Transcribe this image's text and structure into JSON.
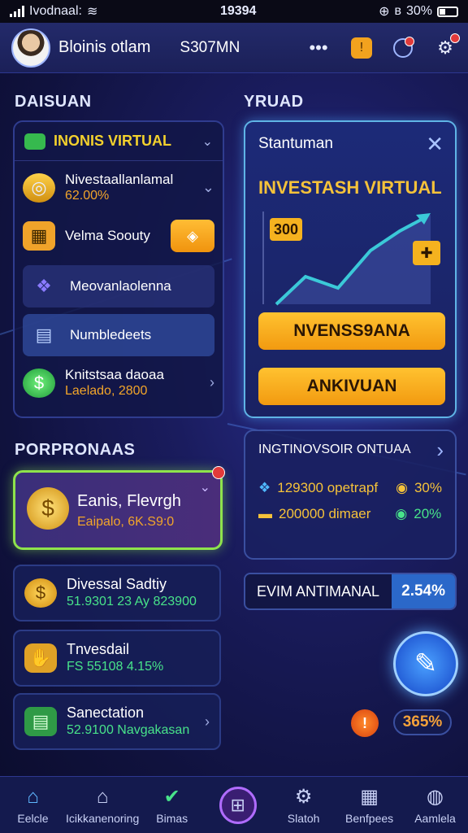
{
  "status_bar": {
    "carrier": "Ivodnaal:",
    "time": "19394",
    "battery": "30%"
  },
  "header": {
    "user_name": "Bloinis otlam",
    "balance": "S307MN",
    "more": "•••"
  },
  "sections": {
    "left_title": "DAISUAN",
    "right_title": "YRUAD",
    "promos_title": "PORPRONAAS"
  },
  "left_panel": {
    "title": "INONIS VIRTUAL",
    "items": [
      {
        "label": "Nivestaallanlamal",
        "sub": "62.00%"
      },
      {
        "label": "Velma Soouty"
      },
      {
        "label": "Meovanlaolenna"
      },
      {
        "label": "Numbledeets"
      },
      {
        "label": "Knitstsaa daoaa",
        "sub": "Laelado, 2800"
      }
    ]
  },
  "right_panel": {
    "header": "Stantuman",
    "title": "INVESTASH VIRTUAL",
    "chart_badge": "300",
    "buttons": [
      "NVENSS9ANA",
      "ANKIVUAN"
    ]
  },
  "promos": [
    {
      "title": "Eanis, Flevrgh",
      "sub": "Eaipalo, 6K.S9:0"
    },
    {
      "title": "Divessal Sadtiy",
      "sub": "51.9301 23  Ay  823900"
    },
    {
      "title": "Tnvesdail",
      "sub": "FS 55108  4.15%"
    },
    {
      "title": "Sanectation",
      "sub": "52.9100  Navgakasan"
    }
  ],
  "insight": {
    "title": "INGTINOVSOIR ONTUAA",
    "rows": [
      {
        "value": "129300 opetrapf",
        "pct": "30%"
      },
      {
        "value": "200000 dimaer",
        "pct": "20%"
      }
    ]
  },
  "bar": {
    "label": "EVIM ANTIMANAL",
    "pct": "2.54%"
  },
  "fab_badge": "365%",
  "nav": [
    "Eelcle",
    "Icikkanenoring",
    "Bimas",
    "",
    "Slatoh",
    "Benfpees",
    "Aamlela"
  ],
  "colors": {
    "accent": "#f7a51c",
    "green": "#48e38a",
    "yellow": "#f3d12d"
  }
}
